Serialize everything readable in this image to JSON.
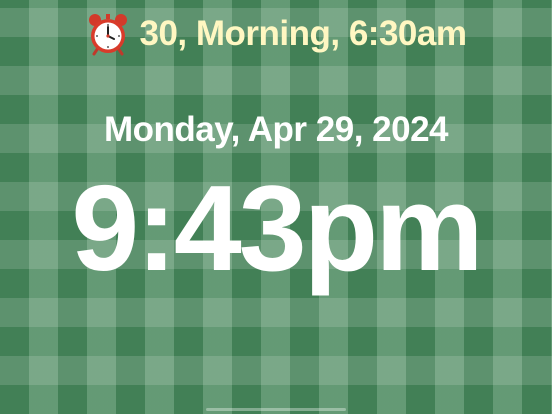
{
  "alarm": {
    "icon": "alarm-clock-icon",
    "text": "30, Morning, 6:30am",
    "text_color": "#fff7c2"
  },
  "date": "Monday, Apr 29, 2024",
  "time": "9:43pm",
  "theme": {
    "background": "#4a8a5e",
    "pattern": "gingham",
    "text_color": "#ffffff"
  }
}
